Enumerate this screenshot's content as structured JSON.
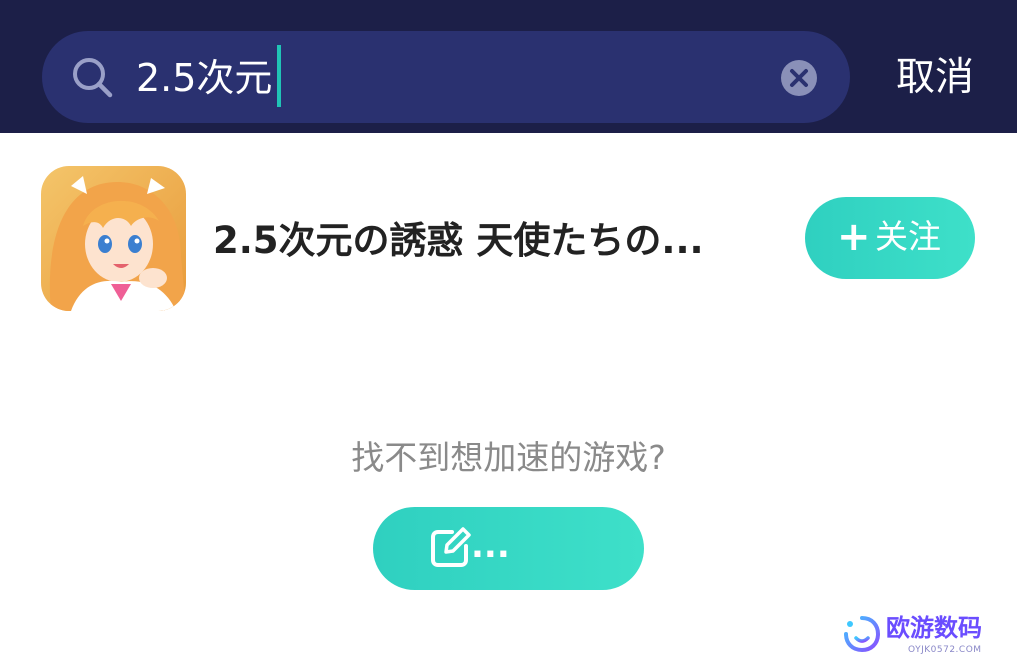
{
  "search": {
    "query": "2.5次元",
    "cancel_label": "取消",
    "icon": "search-icon",
    "clear_icon": "clear-icon"
  },
  "results": [
    {
      "title": "2.5次元の誘惑 天使たちの...",
      "follow_label": "关注",
      "follow_icon": "plus-icon"
    }
  ],
  "not_found": {
    "prompt": "找不到想加速的游戏?",
    "button_label": "...",
    "button_icon": "edit-icon"
  },
  "watermark": {
    "text": "欧游数码",
    "subtext": "OYJK0572.COM"
  },
  "colors": {
    "header_bg": "#1c1f48",
    "search_bg": "#2a3170",
    "accent": "#35d6c4",
    "caret": "#20c4b6"
  }
}
